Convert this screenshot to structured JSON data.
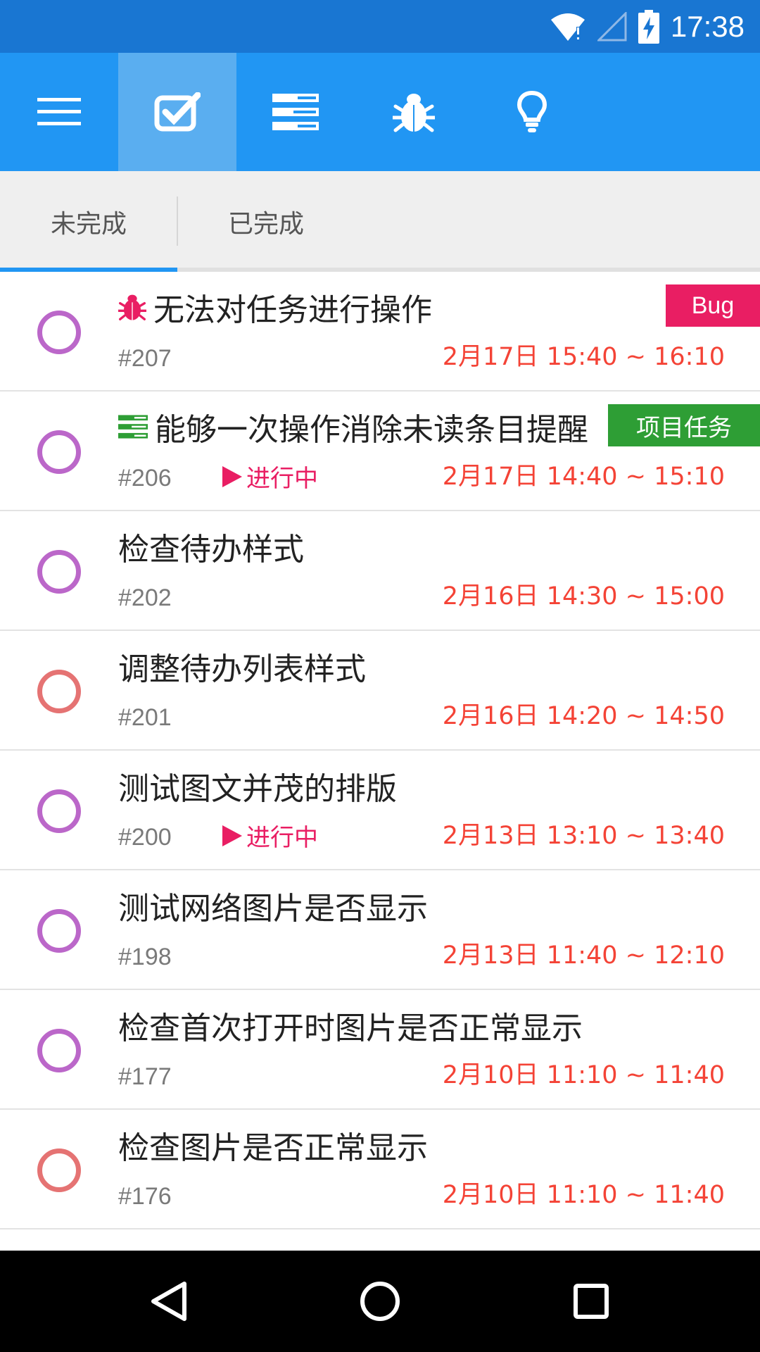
{
  "status_bar": {
    "time": "17:38",
    "icons": [
      "wifi-alert-icon",
      "signal-icon",
      "battery-charging-icon"
    ]
  },
  "toolbar": {
    "items": [
      {
        "name": "menu-icon"
      },
      {
        "name": "checkbox-icon",
        "active": true
      },
      {
        "name": "list-icon"
      },
      {
        "name": "bug-icon"
      },
      {
        "name": "lightbulb-icon"
      }
    ]
  },
  "tabs": [
    {
      "label": "未完成",
      "selected": true
    },
    {
      "label": "已完成",
      "selected": false
    }
  ],
  "tasks": [
    {
      "title": "无法对任务进行操作",
      "number": "#207",
      "time": "2月17日 15:40 ~ 16:10",
      "type_icon": "bug-icon",
      "badge": "Bug",
      "status": "",
      "circle_color": "#bb67c9"
    },
    {
      "title": "能够一次操作消除未读条目提醒",
      "number": "#206",
      "time": "2月17日 14:40 ~ 15:10",
      "type_icon": "project-icon",
      "badge": "项目任务",
      "status": "进行中",
      "circle_color": "#bb67c9"
    },
    {
      "title": "检查待办样式",
      "number": "#202",
      "time": "2月16日 14:30 ~ 15:00",
      "status": "",
      "circle_color": "#bb67c9"
    },
    {
      "title": "调整待办列表样式",
      "number": "#201",
      "time": "2月16日 14:20 ~ 14:50",
      "status": "",
      "circle_color": "#e57373"
    },
    {
      "title": "测试图文并茂的排版",
      "number": "#200",
      "time": "2月13日 13:10 ~ 13:40",
      "status": "进行中",
      "circle_color": "#bb67c9"
    },
    {
      "title": "测试网络图片是否显示",
      "number": "#198",
      "time": "2月13日 11:40 ~ 12:10",
      "status": "",
      "circle_color": "#bb67c9"
    },
    {
      "title": "检查首次打开时图片是否正常显示",
      "number": "#177",
      "time": "2月10日 11:10 ~ 11:40",
      "status": "",
      "circle_color": "#bb67c9"
    },
    {
      "title": "检查图片是否正常显示",
      "number": "#176",
      "time": "2月10日 11:10 ~ 11:40",
      "status": "",
      "circle_color": "#e57373"
    }
  ],
  "colors": {
    "status_bar": "#1976d2",
    "toolbar": "#2196f3",
    "badge_bug": "#e91e63",
    "badge_project": "#2e9e35",
    "time_text": "#f44336",
    "in_progress": "#e91e63"
  },
  "nav_bar": {
    "icons": [
      "back-icon",
      "home-icon",
      "recents-icon"
    ]
  }
}
